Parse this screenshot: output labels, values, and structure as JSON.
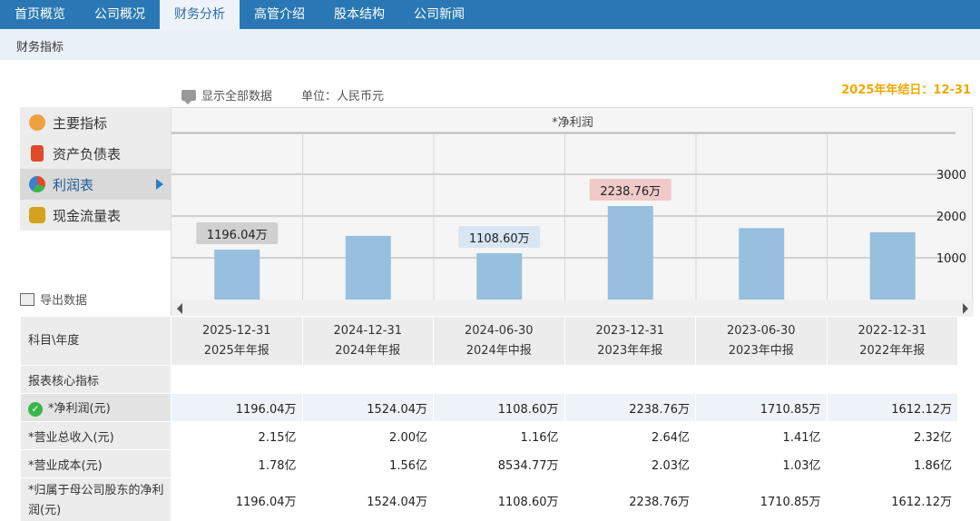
{
  "nav": {
    "tabs": [
      {
        "label": "首页概览"
      },
      {
        "label": "公司概况"
      },
      {
        "label": "财务分析"
      },
      {
        "label": "高管介绍"
      },
      {
        "label": "股本结构"
      },
      {
        "label": "公司新闻"
      }
    ],
    "active": 2
  },
  "subbar": {
    "title": "财务指标"
  },
  "info": {
    "show_all": "显示全部数据",
    "unit": "单位：人民币元",
    "year_end": "2025年年结日：12-31"
  },
  "leftmenu": {
    "items": [
      {
        "label": "主要指标",
        "icon": "flower-icon",
        "color": "#f0a040"
      },
      {
        "label": "资产负债表",
        "icon": "document-icon",
        "color": "#e04a2a"
      },
      {
        "label": "利润表",
        "icon": "pie-chart-icon",
        "color": "#3a7fd0"
      },
      {
        "label": "现金流量表",
        "icon": "coins-icon",
        "color": "#d6a21e"
      }
    ],
    "active": 2
  },
  "export": {
    "label": "导出数据"
  },
  "chart_data": {
    "type": "bar",
    "title": "*净利润",
    "categories": [
      "2025-12-31",
      "2024-12-31",
      "2024-06-30",
      "2023-12-31",
      "2023-06-30",
      "2022-12-31"
    ],
    "values": [
      1196.04,
      1524.04,
      1108.6,
      2238.76,
      1710.85,
      1612.12
    ],
    "data_labels": [
      {
        "index": 0,
        "text": "1196.04万",
        "bg": "#d0d0d0"
      },
      {
        "index": 2,
        "text": "1108.60万",
        "bg": "#d7e6f2"
      },
      {
        "index": 3,
        "text": "2238.76万",
        "bg": "#f0c9c9"
      }
    ],
    "yticks": [
      1000,
      2000,
      3000
    ],
    "ylim": [
      0,
      4000
    ],
    "bar_color": "#97bfde",
    "grid": true
  },
  "table": {
    "header_label": "科目\\年度",
    "columns": [
      {
        "date": "2025-12-31",
        "report": "2025年年报"
      },
      {
        "date": "2024-12-31",
        "report": "2024年年报"
      },
      {
        "date": "2024-06-30",
        "report": "2024年中报"
      },
      {
        "date": "2023-12-31",
        "report": "2023年年报"
      },
      {
        "date": "2023-06-30",
        "report": "2023年中报"
      },
      {
        "date": "2022-12-31",
        "report": "2022年年报"
      }
    ],
    "section": "报表核心指标",
    "rows": [
      {
        "label": "*净利润(元)",
        "values": [
          "1196.04万",
          "1524.04万",
          "1108.60万",
          "2238.76万",
          "1710.85万",
          "1612.12万"
        ]
      },
      {
        "label": "*营业总收入(元)",
        "values": [
          "2.15亿",
          "2.00亿",
          "1.16亿",
          "2.64亿",
          "1.41亿",
          "2.32亿"
        ]
      },
      {
        "label": "*营业成本(元)",
        "values": [
          "1.78亿",
          "1.56亿",
          "8534.77万",
          "2.03亿",
          "1.03亿",
          "1.86亿"
        ]
      },
      {
        "label": "*归属于母公司股东的净利润(元)",
        "values": [
          "1196.04万",
          "1524.04万",
          "1108.60万",
          "2238.76万",
          "1710.85万",
          "1612.12万"
        ]
      }
    ]
  }
}
